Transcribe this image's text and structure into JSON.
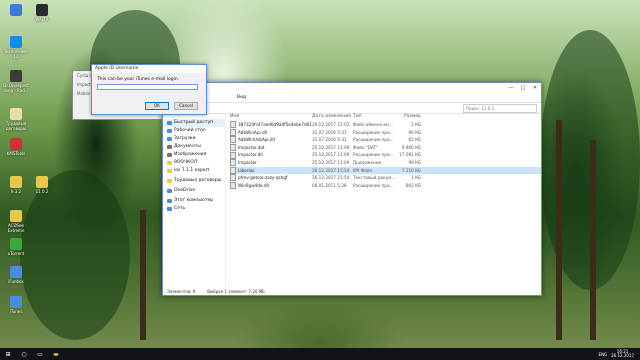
{
  "desktop": {
    "icons": [
      {
        "label": "",
        "color": "#3a7bd5"
      },
      {
        "label": "WALTR",
        "color": "#2b2b2b"
      },
      {
        "label": "TeamViewer 12",
        "color": "#0e8ee9"
      },
      {
        "label": "Dr.Divespect song - Rad...",
        "color": "#3b3b3b"
      },
      {
        "label": "Трудовые договоры",
        "color": "#e8d9a8"
      },
      {
        "label": "KMSTools",
        "color": "#c33"
      },
      {
        "label": "9.3.2",
        "color": "#e8c84a"
      },
      {
        "label": "11.0.2",
        "color": "#e8c84a"
      },
      {
        "label": "ACDSee Extreme",
        "color": "#e8c84a"
      },
      {
        "label": "uTorrent",
        "color": "#3aa83a"
      },
      {
        "label": "iFunbox",
        "color": "#4a8de0"
      },
      {
        "label": "iTunes",
        "color": "#4a8de0"
      }
    ]
  },
  "explorer": {
    "window_controls": [
      "—",
      "□",
      "✕"
    ],
    "ribbon_tab": "Вид",
    "search_placeholder": "Поиск: 11.0.2",
    "columns": [
      "Имя",
      "Дата изменения",
      "Тип",
      "Размер"
    ],
    "nav": [
      {
        "label": "Быстрый доступ",
        "color": "#4a8de0",
        "selected": true
      },
      {
        "label": "Рабочий стол",
        "color": "#4a8de0"
      },
      {
        "label": "Загрузки",
        "color": "#4a8de0"
      },
      {
        "label": "Документы",
        "color": "#777"
      },
      {
        "label": "Изображения",
        "color": "#777"
      },
      {
        "label": "9ООЧКОЛ",
        "color": "#e8c84a"
      },
      {
        "label": "ios 7.1.1 export",
        "color": "#e8c84a"
      },
      {
        "label": "Трудовые договоры",
        "color": "#e8c84a"
      },
      {
        "label": "OneDrive",
        "color": "#4a8de0"
      },
      {
        "label": "Этот компьютер",
        "color": "#4a8de0"
      },
      {
        "label": "Сеть",
        "color": "#4a8de0"
      }
    ],
    "files": [
      {
        "name": "387324fc47aed0d9a0f5e4ebe7d0133b...",
        "date": "26.12.2017 15:02",
        "type": "Файл обмена ин...",
        "size": "2 КБ"
      },
      {
        "name": "AdbWinApi.dll",
        "date": "31.07.2016 5:31",
        "type": "Расширение при...",
        "size": "96 КБ"
      },
      {
        "name": "AdbWinUsbApi.dll",
        "date": "31.07.2016 5:31",
        "type": "Расширение при...",
        "size": "62 КБ"
      },
      {
        "name": "Impactor.dat",
        "date": "25.10.2017 11:09",
        "type": "Файл \"DAT\"",
        "size": "9 866 КБ"
      },
      {
        "name": "Impactor.dll",
        "date": "25.10.2017 11:09",
        "type": "Расширение при...",
        "size": "17 081 КБ"
      },
      {
        "name": "Impactor",
        "date": "25.10.2017 11:09",
        "type": "Приложение",
        "size": "99 КБ"
      },
      {
        "name": "Liberios",
        "date": "26.12.2017 15:54",
        "type": "IPA Файл",
        "size": "7 216 КБ",
        "selected": true
      },
      {
        "name": "pfrev-getolo-zazy-qshgf",
        "date": "26.12.2017 15:54",
        "type": "Текстовый докум...",
        "size": "1 КБ"
      },
      {
        "name": "Win6gw4de.dll",
        "date": "08.01.2011 5:28",
        "type": "Расширение при...",
        "size": "802 КБ"
      }
    ],
    "status": {
      "count": "Элементов: 9",
      "selected": "Выбран 1 элемент: 7,20 МБ"
    }
  },
  "dialog_back": {
    "title": "Cydia Impactor",
    "line1": "Impactor",
    "line2": "Mobile Device"
  },
  "dialog": {
    "title": "Apple ID Username",
    "prompt": "This can be your iTunes e-mail login.",
    "input_value": "",
    "ok_label": "OK",
    "cancel_label": "Cancel"
  },
  "taskbar": {
    "tray_lang": "ENG",
    "time": "16:21",
    "date": "26.12.2017"
  }
}
